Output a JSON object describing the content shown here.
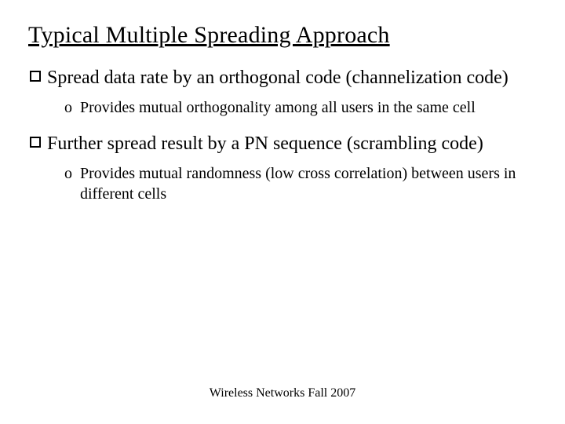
{
  "title": "Typical Multiple Spreading Approach",
  "bullets": [
    {
      "text": "Spread data rate by an orthogonal code (channelization code)",
      "sub": [
        "Provides mutual orthogonality among all users in the same cell"
      ]
    },
    {
      "text": "Further spread result by a PN sequence (scrambling code)",
      "sub": [
        "Provides mutual randomness (low cross correlation) between users in different cells"
      ]
    }
  ],
  "sub_marker": "o",
  "footer": "Wireless Networks Fall 2007"
}
